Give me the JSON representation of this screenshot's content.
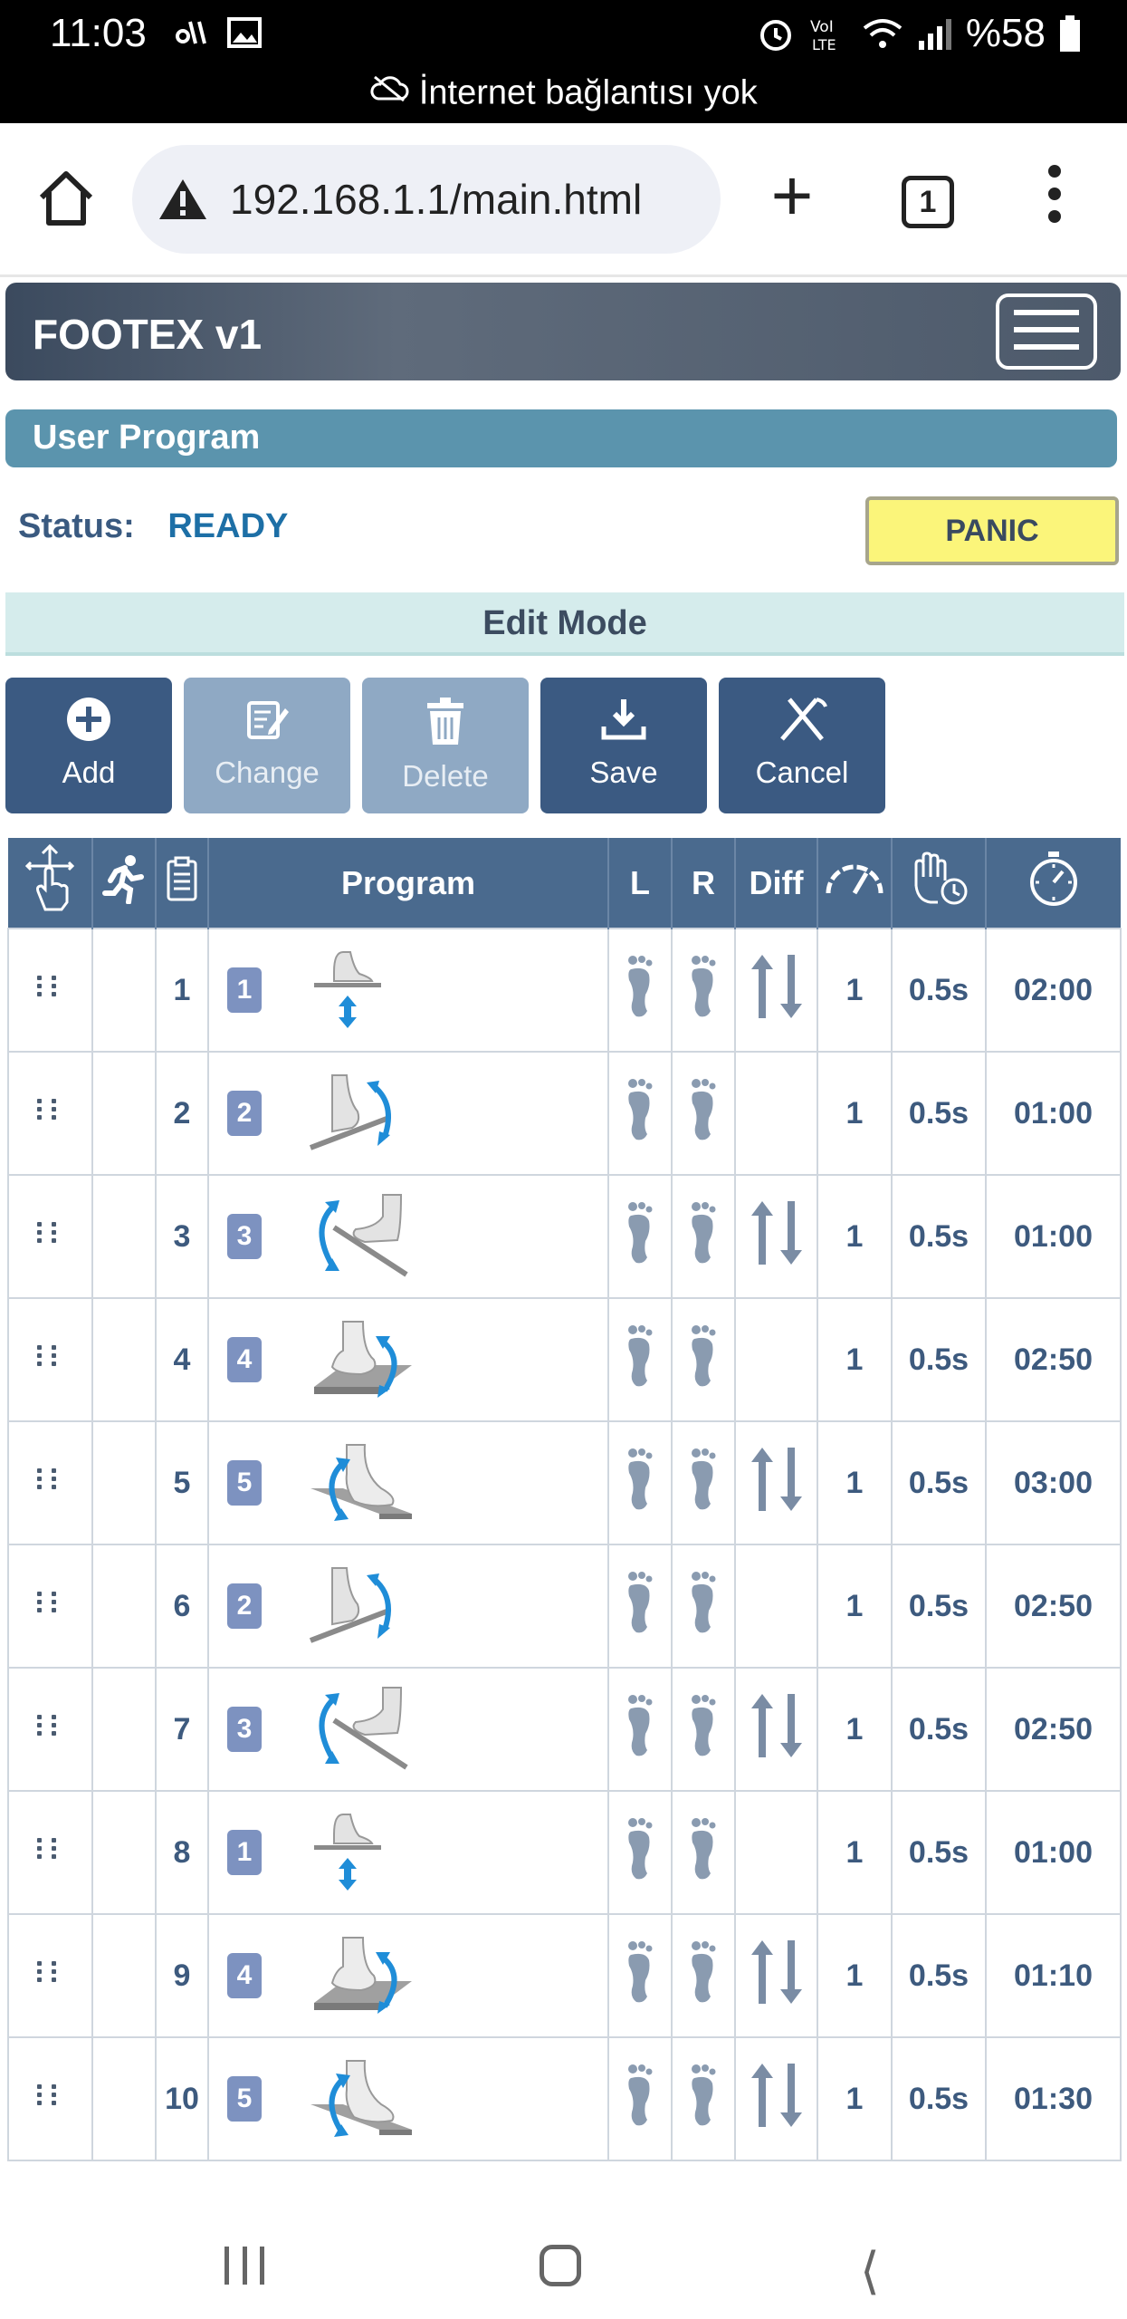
{
  "status_bar": {
    "time": "11:03",
    "battery": "%58",
    "network_notice": "İnternet bağlantısı yok"
  },
  "browser": {
    "url": "192.168.1.1/main.html",
    "tab_count": "1"
  },
  "app": {
    "title": "FOOTEX v1",
    "section": "User Program",
    "status_label": "Status:",
    "status_value": "READY",
    "panic_label": "PANIC",
    "mode_label": "Edit Mode"
  },
  "toolbar": {
    "add": "Add",
    "change": "Change",
    "delete": "Delete",
    "save": "Save",
    "cancel": "Cancel"
  },
  "table": {
    "headers": {
      "program": "Program",
      "l": "L",
      "r": "R",
      "diff": "Diff"
    },
    "rows": [
      {
        "num": "1",
        "prog": "1",
        "diff": true,
        "speed": "1",
        "hold": "0.5s",
        "time": "02:00"
      },
      {
        "num": "2",
        "prog": "2",
        "diff": false,
        "speed": "1",
        "hold": "0.5s",
        "time": "01:00"
      },
      {
        "num": "3",
        "prog": "3",
        "diff": true,
        "speed": "1",
        "hold": "0.5s",
        "time": "01:00"
      },
      {
        "num": "4",
        "prog": "4",
        "diff": false,
        "speed": "1",
        "hold": "0.5s",
        "time": "02:50"
      },
      {
        "num": "5",
        "prog": "5",
        "diff": true,
        "speed": "1",
        "hold": "0.5s",
        "time": "03:00"
      },
      {
        "num": "6",
        "prog": "2",
        "diff": false,
        "speed": "1",
        "hold": "0.5s",
        "time": "02:50"
      },
      {
        "num": "7",
        "prog": "3",
        "diff": true,
        "speed": "1",
        "hold": "0.5s",
        "time": "02:50"
      },
      {
        "num": "8",
        "prog": "1",
        "diff": false,
        "speed": "1",
        "hold": "0.5s",
        "time": "01:00"
      },
      {
        "num": "9",
        "prog": "4",
        "diff": true,
        "speed": "1",
        "hold": "0.5s",
        "time": "01:10"
      },
      {
        "num": "10",
        "prog": "5",
        "diff": true,
        "speed": "1",
        "hold": "0.5s",
        "time": "01:30"
      }
    ]
  },
  "colors": {
    "header": "#4a6a8e",
    "button_dark": "#3b5a82",
    "button_disabled": "#8fa9c4",
    "panic": "#fbf57a",
    "status_ready": "#1d6fa6"
  }
}
